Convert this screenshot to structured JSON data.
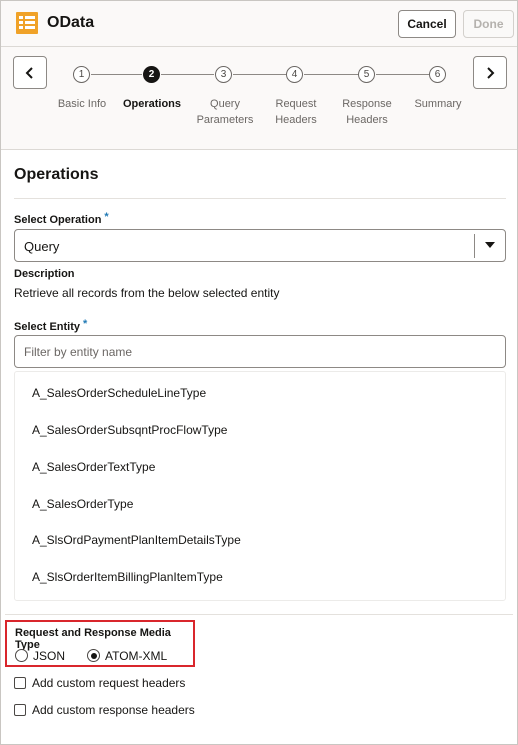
{
  "header": {
    "title": "OData",
    "cancel_label": "Cancel",
    "done_label": "Done"
  },
  "stepper": {
    "steps": [
      {
        "num": "1",
        "label": "Basic Info",
        "active": false
      },
      {
        "num": "2",
        "label": "Operations",
        "active": true
      },
      {
        "num": "3",
        "label": "Query Parameters",
        "active": false
      },
      {
        "num": "4",
        "label": "Request Headers",
        "active": false
      },
      {
        "num": "5",
        "label": "Response Headers",
        "active": false
      },
      {
        "num": "6",
        "label": "Summary",
        "active": false
      }
    ]
  },
  "operations": {
    "title": "Operations",
    "select_label": "Select Operation",
    "required_mark": "*",
    "selected_operation": "Query",
    "description_label": "Description",
    "description_text": "Retrieve all records from the below selected entity",
    "entity_label": "Select Entity",
    "entity_placeholder": "Filter by entity name",
    "entities": [
      "A_SalesOrderScheduleLineType",
      "A_SalesOrderSubsqntProcFlowType",
      "A_SalesOrderTextType",
      "A_SalesOrderType",
      "A_SlsOrdPaymentPlanItemDetailsType",
      "A_SlsOrderItemBillingPlanItemType"
    ]
  },
  "media": {
    "label": "Request and Response Media Type",
    "options": [
      "JSON",
      "ATOM-XML"
    ],
    "selected": "ATOM-XML"
  },
  "checkboxes": {
    "request_headers": "Add custom request headers",
    "response_headers": "Add custom response headers"
  },
  "colors": {
    "accent": "#f0a228",
    "highlight_border": "#d9262c",
    "required": "#227ab5"
  }
}
